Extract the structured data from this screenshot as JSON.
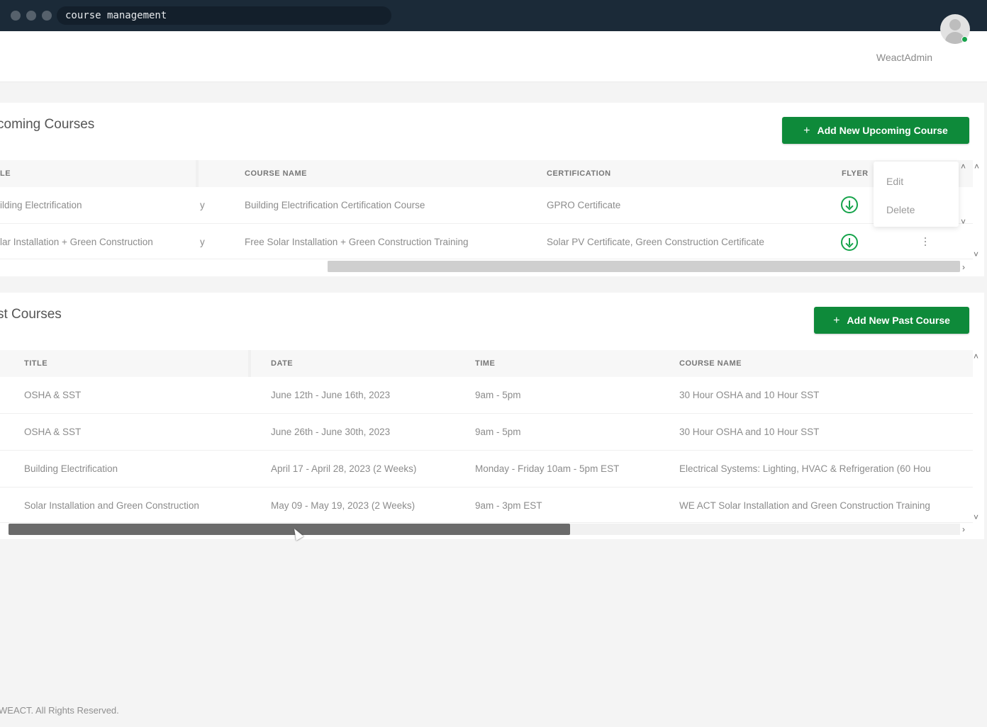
{
  "window": {
    "address": "course management"
  },
  "header": {
    "user_name": "WeactAdmin"
  },
  "upcoming": {
    "title": "coming Courses",
    "add_button": "Add New Upcoming Course",
    "columns": [
      "LE",
      "COURSE NAME",
      "CERTIFICATION",
      "FLYER"
    ],
    "rows": [
      {
        "title": "ilding Electrification",
        "mid": "y",
        "course_name": "Building Electrification Certification Course",
        "certification": "GPRO Certificate"
      },
      {
        "title": "lar Installation + Green Construction",
        "mid": "y",
        "course_name": "Free Solar Installation + Green Construction Training",
        "certification": "Solar PV Certificate, Green Construction Certificate"
      }
    ],
    "menu": {
      "edit": "Edit",
      "delete": "Delete"
    }
  },
  "past": {
    "title": "st Courses",
    "add_button": "Add New Past Course",
    "columns": [
      "TITLE",
      "DATE",
      "TIME",
      "COURSE NAME"
    ],
    "rows": [
      {
        "title": "OSHA & SST",
        "date": "June 12th - June 16th, 2023",
        "time": "9am - 5pm",
        "course_name": "30 Hour OSHA and 10 Hour SST"
      },
      {
        "title": "OSHA & SST",
        "date": "June 26th - June 30th, 2023",
        "time": "9am - 5pm",
        "course_name": "30 Hour OSHA and 10 Hour SST"
      },
      {
        "title": "Building Electrification",
        "date": "April 17 - April 28, 2023 (2 Weeks)",
        "time": "Monday - Friday 10am - 5pm EST",
        "course_name": "Electrical Systems: Lighting, HVAC & Refrigeration (60 Hou"
      },
      {
        "title": "Solar Installation and Green Construction",
        "date": "May 09 - May 19, 2023 (2 Weeks)",
        "time": "9am - 3pm EST",
        "course_name": "WE ACT Solar Installation and Green Construction Training"
      }
    ]
  },
  "footer": {
    "text": "WEACT. All Rights Reserved."
  },
  "colors": {
    "accent": "#0e8a3a",
    "titlebar": "#1b2a38"
  }
}
